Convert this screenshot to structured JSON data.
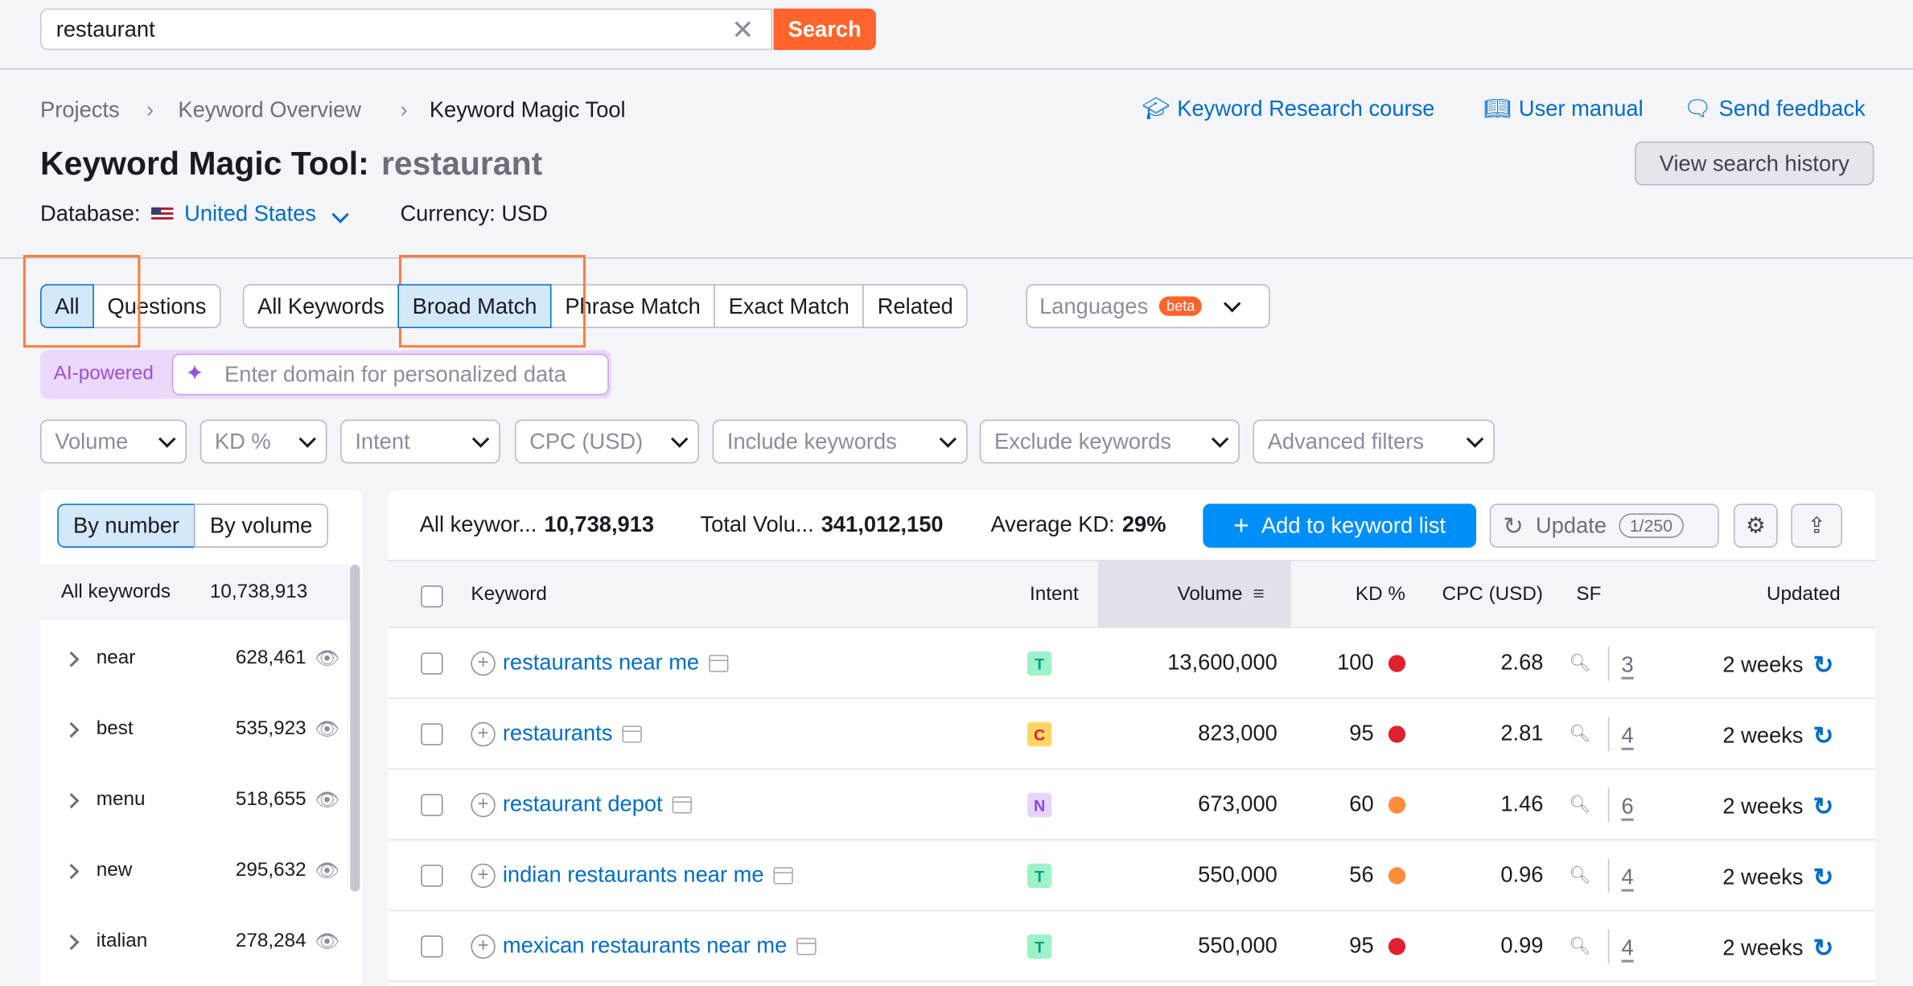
{
  "search": {
    "value": "restaurant",
    "button": "Search"
  },
  "breadcrumbs": [
    "Projects",
    "Keyword Overview",
    "Keyword Magic Tool"
  ],
  "top_links": {
    "course": "Keyword Research course",
    "manual": "User manual",
    "feedback": "Send feedback"
  },
  "header": {
    "title": "Keyword Magic Tool:",
    "query": "restaurant",
    "history_button": "View search history"
  },
  "database": {
    "label": "Database:",
    "value": "United States",
    "currency": "Currency: USD"
  },
  "tabs_group1": [
    "All",
    "Questions"
  ],
  "tabs_group2": [
    "All Keywords",
    "Broad Match",
    "Phrase Match",
    "Exact Match",
    "Related"
  ],
  "languages": {
    "label": "Languages",
    "badge": "beta"
  },
  "ai": {
    "label": "AI-powered",
    "placeholder": "Enter domain for personalized data"
  },
  "filters": [
    "Volume",
    "KD %",
    "Intent",
    "CPC (USD)",
    "Include keywords",
    "Exclude keywords",
    "Advanced filters"
  ],
  "view_toggle": [
    "By number",
    "By volume"
  ],
  "groups": {
    "all_label": "All keywords",
    "all_count": "10,738,913",
    "items": [
      {
        "label": "near",
        "count": "628,461"
      },
      {
        "label": "best",
        "count": "535,923"
      },
      {
        "label": "menu",
        "count": "518,655"
      },
      {
        "label": "new",
        "count": "295,632"
      },
      {
        "label": "italian",
        "count": "278,284"
      }
    ]
  },
  "stats": {
    "all_label": "All keywor...",
    "all_value": "10,738,913",
    "vol_label": "Total Volu...",
    "vol_value": "341,012,150",
    "kd_label": "Average KD:",
    "kd_value": "29%"
  },
  "actions": {
    "add": "Add to keyword list",
    "update": "Update",
    "update_count": "1/250"
  },
  "columns": [
    "Keyword",
    "Intent",
    "Volume",
    "KD %",
    "CPC (USD)",
    "SF",
    "Updated"
  ],
  "rows": [
    {
      "keyword": "restaurants near me",
      "intent": "T",
      "volume": "13,600,000",
      "kd": "100",
      "kd_color": "#e0202e",
      "cpc": "2.68",
      "sf": "3",
      "updated": "2 weeks"
    },
    {
      "keyword": "restaurants",
      "intent": "C",
      "volume": "823,000",
      "kd": "95",
      "kd_color": "#e0202e",
      "cpc": "2.81",
      "sf": "4",
      "updated": "2 weeks"
    },
    {
      "keyword": "restaurant depot",
      "intent": "N",
      "volume": "673,000",
      "kd": "60",
      "kd_color": "#ff8c3a",
      "cpc": "1.46",
      "sf": "6",
      "updated": "2 weeks"
    },
    {
      "keyword": "indian restaurants near me",
      "intent": "T",
      "volume": "550,000",
      "kd": "56",
      "kd_color": "#ff8c3a",
      "cpc": "0.96",
      "sf": "4",
      "updated": "2 weeks"
    },
    {
      "keyword": "mexican restaurants near me",
      "intent": "T",
      "volume": "550,000",
      "kd": "95",
      "kd_color": "#e0202e",
      "cpc": "0.99",
      "sf": "4",
      "updated": "2 weeks"
    }
  ]
}
